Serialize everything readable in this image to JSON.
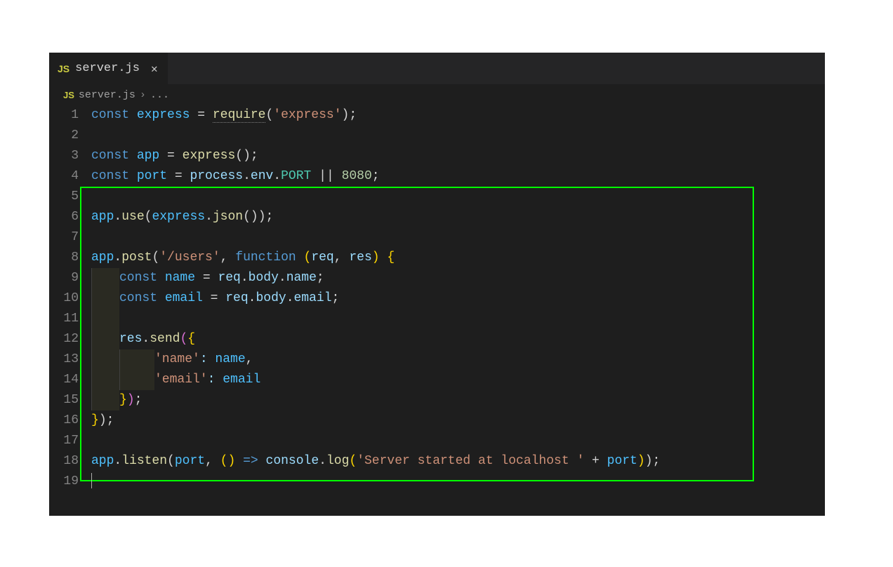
{
  "tab": {
    "icon": "JS",
    "filename": "server.js"
  },
  "breadcrumb": {
    "icon": "JS",
    "filename": "server.js",
    "more": "..."
  },
  "lines": {
    "n1": "1",
    "n2": "2",
    "n3": "3",
    "n4": "4",
    "n5": "5",
    "n6": "6",
    "n7": "7",
    "n8": "8",
    "n9": "9",
    "n10": "10",
    "n11": "11",
    "n12": "12",
    "n13": "13",
    "n14": "14",
    "n15": "15",
    "n16": "16",
    "n17": "17",
    "n18": "18",
    "n19": "19"
  },
  "tok": {
    "const": "const",
    "function": "function",
    "express_var": "express",
    "require": "require",
    "str_express": "'express'",
    "app": "app",
    "port": "port",
    "process": "process",
    "env": "env",
    "PORT": "PORT",
    "oror": "||",
    "n8080": "8080",
    "use": "use",
    "json": "json",
    "post": "post",
    "str_users": "'/users'",
    "req": "req",
    "res": "res",
    "name": "name",
    "email": "email",
    "body": "body",
    "send": "send",
    "str_name": "'name'",
    "str_email": "'email'",
    "listen": "listen",
    "console": "console",
    "log": "log",
    "str_server": "'Server started at localhost '",
    "eq": " = ",
    "arrow": "=>",
    "dot": ".",
    "comma": ", ",
    "colon": ": ",
    "lp": "(",
    "rp": ")",
    "lb": "{",
    "rb": "}",
    "semi": ";",
    "sp": " ",
    "plus": " + "
  }
}
